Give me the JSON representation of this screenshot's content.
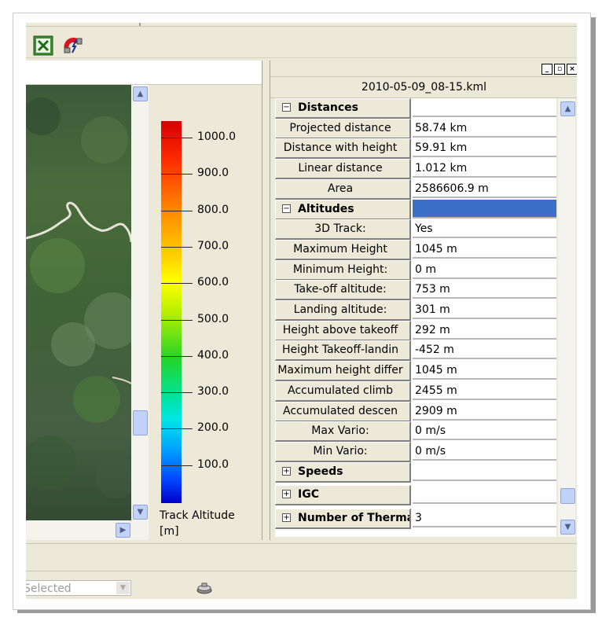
{
  "map_pane": {
    "legend": {
      "title": "Track Altitude",
      "unit": "[m]",
      "ticks": [
        "1000.0",
        "900.0",
        "800.0",
        "700.0",
        "600.0",
        "500.0",
        "400.0",
        "300.0",
        "200.0",
        "100.0"
      ]
    }
  },
  "properties": {
    "file_name": "2010-05-09_08-15.kml",
    "rows": [
      {
        "type": "category",
        "expander": "−",
        "name": "Distances",
        "value": ""
      },
      {
        "type": "item",
        "name": "Projected distance",
        "value": "58.74 km"
      },
      {
        "type": "item",
        "name": "Distance with height",
        "value": "59.91 km"
      },
      {
        "type": "item",
        "name": "Linear distance",
        "value": "1.012 km"
      },
      {
        "type": "item",
        "name": "Area",
        "value": "2586606.9 m"
      },
      {
        "type": "category",
        "expander": "−",
        "name": "Altitudes",
        "value": "",
        "selected": true
      },
      {
        "type": "item",
        "name": "3D Track:",
        "value": "Yes"
      },
      {
        "type": "item",
        "name": "Maximum Height",
        "value": "1045 m"
      },
      {
        "type": "item",
        "name": "Minimum Height:",
        "value": "0 m"
      },
      {
        "type": "item",
        "name": "Take-off altitude:",
        "value": "753 m"
      },
      {
        "type": "item",
        "name": "Landing altitude:",
        "value": "301 m"
      },
      {
        "type": "item",
        "name": "Height above takeoff",
        "value": "292 m"
      },
      {
        "type": "item",
        "name": "Height Takeoff-landin",
        "value": "-452 m"
      },
      {
        "type": "item",
        "name": "Maximum height differ",
        "value": "1045 m"
      },
      {
        "type": "item",
        "name": "Accumulated climb",
        "value": "2455 m"
      },
      {
        "type": "item",
        "name": "Accumulated descen",
        "value": "2909 m"
      },
      {
        "type": "item",
        "name": "Max Vario:",
        "value": "0 m/s"
      },
      {
        "type": "item",
        "name": "Min Vario:",
        "value": "0 m/s"
      },
      {
        "type": "category",
        "expander": "+",
        "name": "Speeds",
        "value": ""
      },
      {
        "type": "category",
        "expander": "+",
        "name": "IGC",
        "value": ""
      },
      {
        "type": "category",
        "expander": "+",
        "name": "Number of Thermal",
        "value": "3"
      }
    ]
  },
  "status_bar": {
    "combo_value": "Selected"
  },
  "colors": {
    "selection": "#3b6fc8",
    "window_bg": "#ece9d8",
    "scrollbar_button": "#c1d3fb"
  }
}
